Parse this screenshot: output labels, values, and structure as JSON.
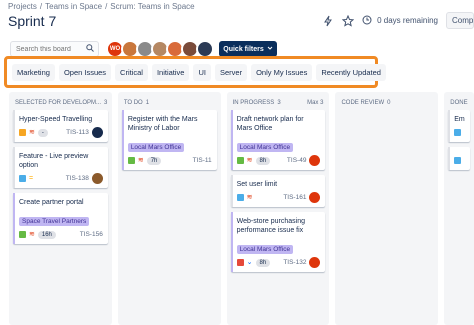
{
  "breadcrumb": [
    "Projects",
    "/",
    "Teams in Space",
    "/",
    "Scrum: Teams in Space"
  ],
  "title": "Sprint 7",
  "header": {
    "days_remaining": "0 days remaining",
    "complete_label": "Complete sprint"
  },
  "search": {
    "placeholder": "Search this board"
  },
  "quick_filters_label": "Quick filters",
  "filters": [
    "Marketing",
    "Open Issues",
    "Critical",
    "Initiative",
    "UI",
    "Server",
    "Only My Issues",
    "Recently Updated"
  ],
  "columns": [
    {
      "title": "SELECTED FOR DEVELOPM...",
      "count": "3",
      "max": "",
      "cards": [
        {
          "summary": "Hyper-Speed Travelling",
          "epic": "",
          "type_color": "#f6a623",
          "prio": "≋",
          "prio_color": "#de350b",
          "est": "-",
          "key": "TIS-113",
          "assignee": "#172b4d"
        },
        {
          "summary": "Feature - Live preview option",
          "epic": "",
          "type_color": "#4bade8",
          "prio": "=",
          "prio_color": "#ffab00",
          "est": "",
          "key": "TIS-138",
          "assignee": "#8b5a2b"
        },
        {
          "summary": "Create partner portal",
          "epic": "Space Travel Partners",
          "type_color": "#65ba43",
          "prio": "≋",
          "prio_color": "#de350b",
          "est": "16h",
          "key": "TIS-156",
          "assignee": ""
        }
      ]
    },
    {
      "title": "TO DO",
      "count": "1",
      "max": "",
      "cards": [
        {
          "summary": "Register with the Mars Ministry of Labor",
          "epic": "Local Mars Office",
          "type_color": "#65ba43",
          "prio": "≋",
          "prio_color": "#de350b",
          "est": "7h",
          "key": "TIS-11",
          "assignee": ""
        }
      ]
    },
    {
      "title": "IN PROGRESS",
      "count": "3",
      "max": "Max 3",
      "cards": [
        {
          "summary": "Draft network plan for Mars Office",
          "epic": "Local Mars Office",
          "type_color": "#65ba43",
          "prio": "≋",
          "prio_color": "#de350b",
          "est": "8h",
          "key": "TIS-49",
          "assignee": "#de350b"
        },
        {
          "summary": "Set user limit",
          "epic": "",
          "type_color": "#4bade8",
          "prio": "≋",
          "prio_color": "#de350b",
          "est": "",
          "key": "TIS-161",
          "assignee": "#de350b"
        },
        {
          "summary": "Web-store purchasing performance issue fix",
          "epic": "Local Mars Office",
          "type_color": "#e5493a",
          "prio": "⌄",
          "prio_color": "#0065ff",
          "est": "8h",
          "key": "TIS-132",
          "assignee": "#de350b"
        }
      ]
    },
    {
      "title": "CODE REVIEW",
      "count": "0",
      "max": "",
      "cards": []
    },
    {
      "title": "DONE",
      "count": "",
      "max": "",
      "cards": [
        {
          "summary": "Em",
          "epic": "",
          "type_color": "#4bade8",
          "prio": "",
          "prio_color": "#de350b",
          "est": "",
          "key": "",
          "assignee": ""
        },
        {
          "summary": "",
          "epic": "",
          "type_color": "#4bade8",
          "prio": "",
          "prio_color": "#de350b",
          "est": "",
          "key": "",
          "assignee": ""
        }
      ]
    }
  ],
  "colors": {
    "accent": "#0a2e5c",
    "filter_highlight": "#f08a24",
    "epic_bg": "#c0b6f2"
  }
}
